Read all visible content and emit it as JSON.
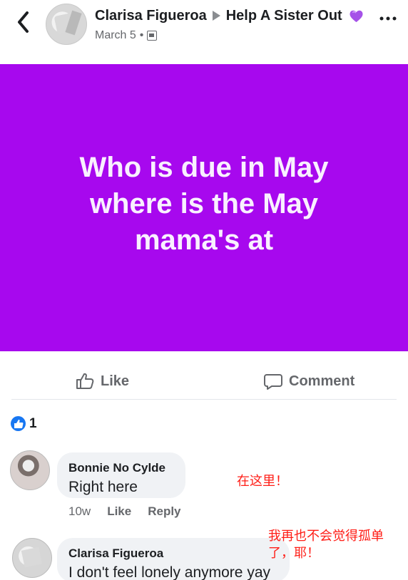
{
  "post": {
    "author": "Clarisa Figueroa",
    "group": "Help A Sister Out",
    "date": "March 5",
    "meta_separator": "•",
    "image_text_lines": [
      "Who is due in May",
      "where is the May",
      "mama's at"
    ],
    "image_background": "#a708ee"
  },
  "actions": {
    "like": "Like",
    "comment": "Comment"
  },
  "reactions": {
    "count": "1"
  },
  "comments": [
    {
      "author": "Bonnie No Cylde",
      "text": "Right here",
      "time": "10w",
      "like": "Like",
      "reply": "Reply"
    },
    {
      "author": "Clarisa Figueroa",
      "text": "I don't feel lonely anymore yay"
    }
  ],
  "annotations": {
    "first": "在这里！",
    "second": "我再也不会觉得孤单了，耶！"
  },
  "colors": {
    "like_blue": "#1877f2",
    "annotation_red": "#ff1d16",
    "muted_text": "#65676b"
  }
}
